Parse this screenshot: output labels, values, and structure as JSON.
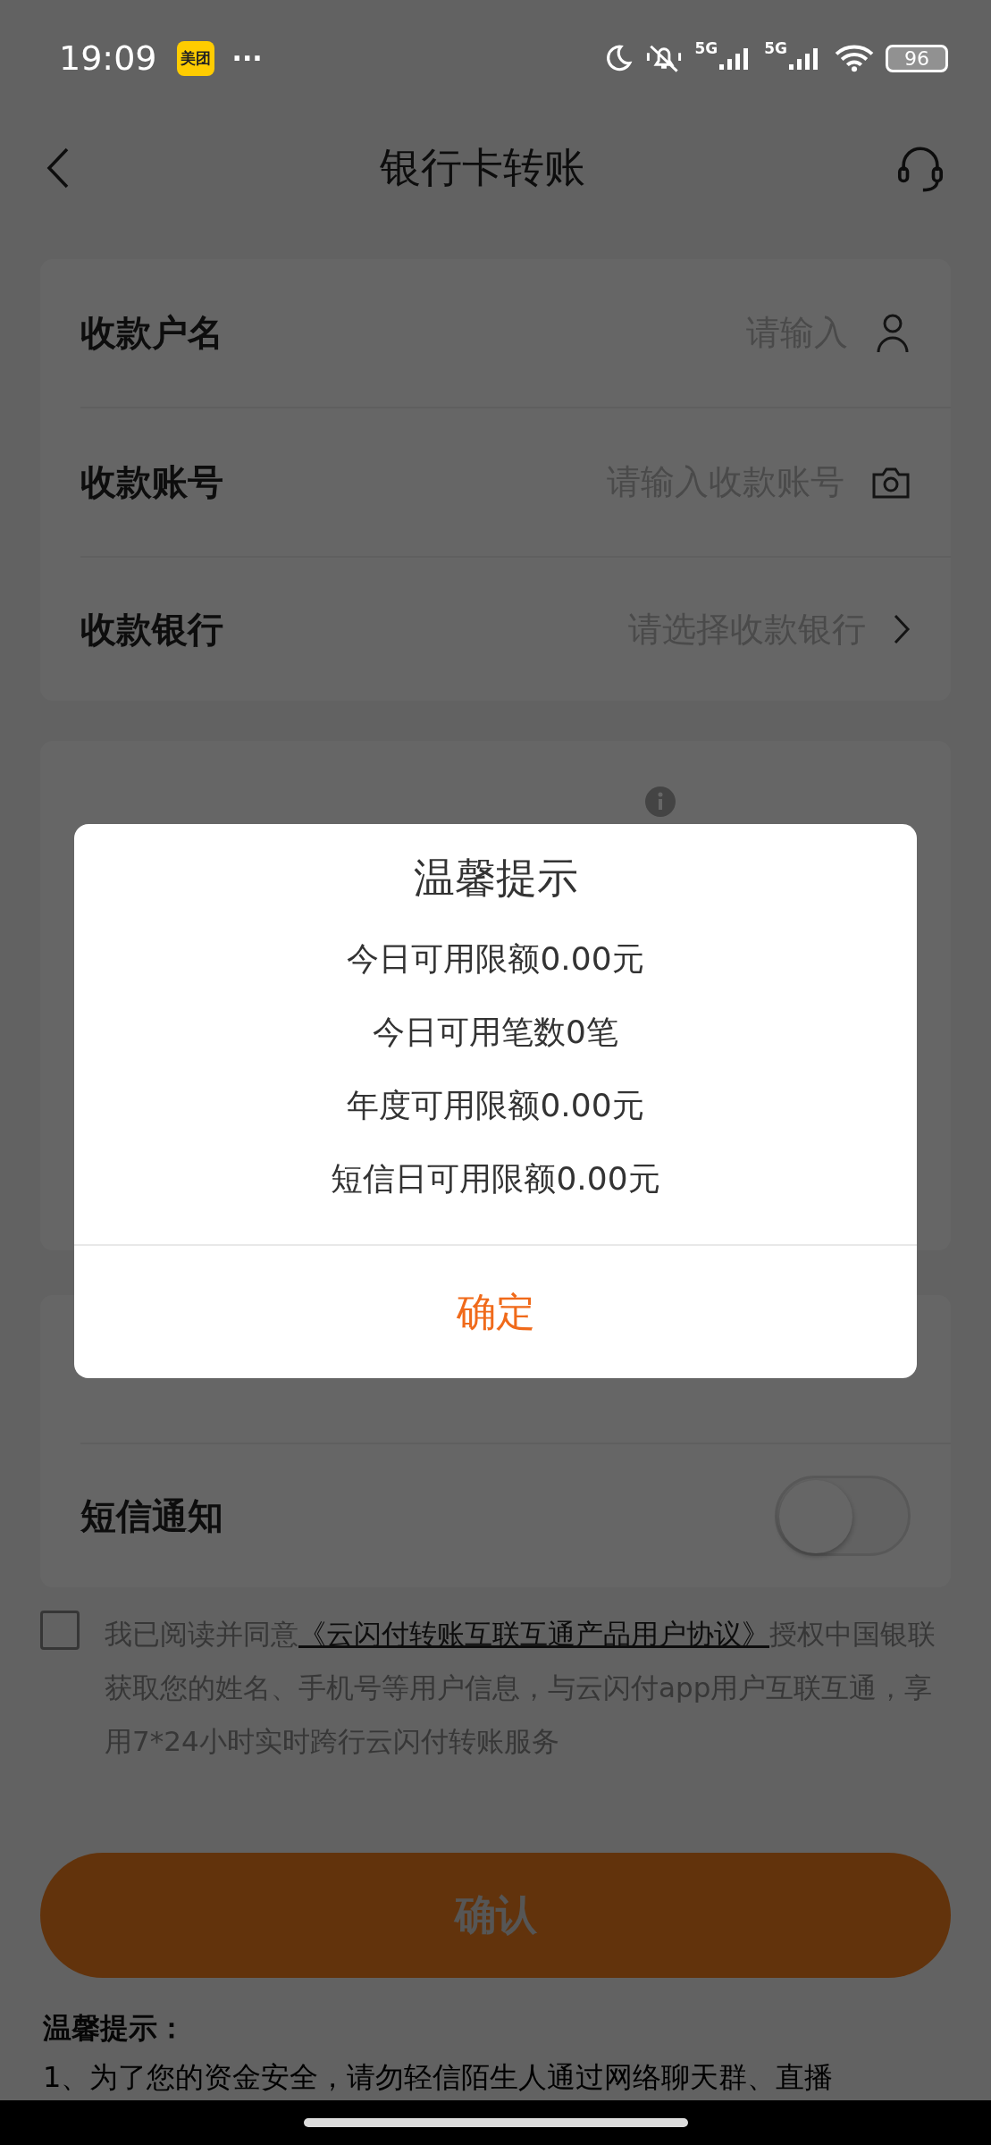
{
  "status_bar": {
    "time": "19:09",
    "app_badge": "美团",
    "more": "···",
    "network_1": "5G",
    "network_2": "5G",
    "battery": "96"
  },
  "header": {
    "title": "银行卡转账"
  },
  "payee_fields": [
    {
      "label": "收款户名",
      "placeholder": "请输入",
      "kind": "person"
    },
    {
      "label": "收款账号",
      "placeholder": "请输入收款账号",
      "kind": "camera"
    },
    {
      "label": "收款银行",
      "placeholder": "请选择收款银行",
      "kind": "chevron"
    }
  ],
  "sms_notice": {
    "label": "短信通知",
    "on": false
  },
  "agreement": {
    "checked": false,
    "prefix": "我已阅读并同意",
    "link": "《云闪付转账互联互通产品用户协议》",
    "suffix": "授权中国银联获取您的姓名、手机号等用户信息，与云闪付app用户互联互通，享用7*24小时实时跨行云闪付转账服务"
  },
  "confirm_button": {
    "label": "确认",
    "disabled": true
  },
  "tips": {
    "title": "温馨提示：",
    "lines": [
      "1、为了您的资金安全，请勿轻信陌生人通过网络聊天群、直播"
    ]
  },
  "dialog": {
    "title": "温馨提示",
    "lines": [
      "今日可用限额0.00元",
      "今日可用笔数0笔",
      "年度可用限额0.00元",
      "短信日可用限额0.00元"
    ],
    "button": "确定"
  }
}
